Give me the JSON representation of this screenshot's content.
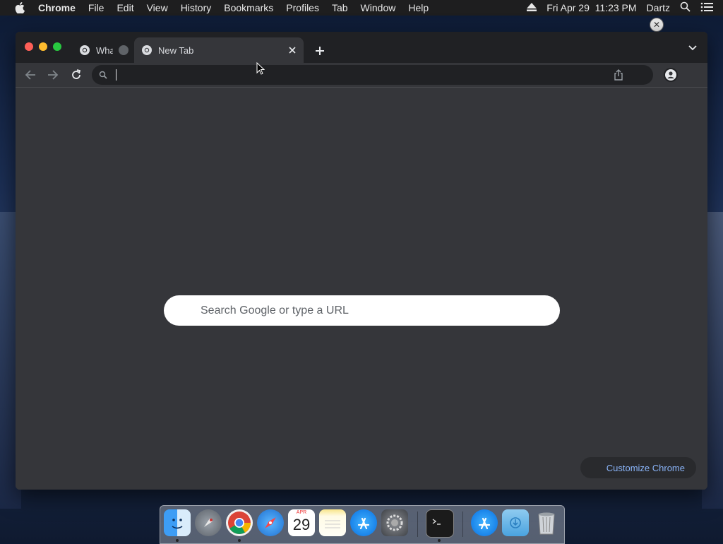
{
  "menubar": {
    "app": "Chrome",
    "items": [
      "File",
      "Edit",
      "View",
      "History",
      "Bookmarks",
      "Profiles",
      "Tab",
      "Window",
      "Help"
    ],
    "datetime": "Fri Apr 29  11:23 PM",
    "user": "Dartz"
  },
  "browser": {
    "tabs": [
      {
        "title": "Wha",
        "icon": "chrome-icon"
      },
      {
        "title": "New Tab",
        "icon": "chrome-icon",
        "active": true
      }
    ],
    "omnibox": {
      "value": ""
    }
  },
  "ntp": {
    "search_placeholder": "Search Google or type a URL",
    "customize_label": "Customize Chrome"
  },
  "dock": {
    "apps": [
      "finder",
      "launchpad",
      "chrome",
      "safari",
      "calendar",
      "notes",
      "app-store",
      "system-preferences",
      "terminal",
      "app-store-alt",
      "downloads-folder",
      "trash"
    ],
    "calendar": {
      "month": "APR",
      "day": "29"
    }
  },
  "colors": {
    "accent_link": "#8ab4f8",
    "window_bg": "#35363a",
    "tabstrip_bg": "#202124"
  }
}
